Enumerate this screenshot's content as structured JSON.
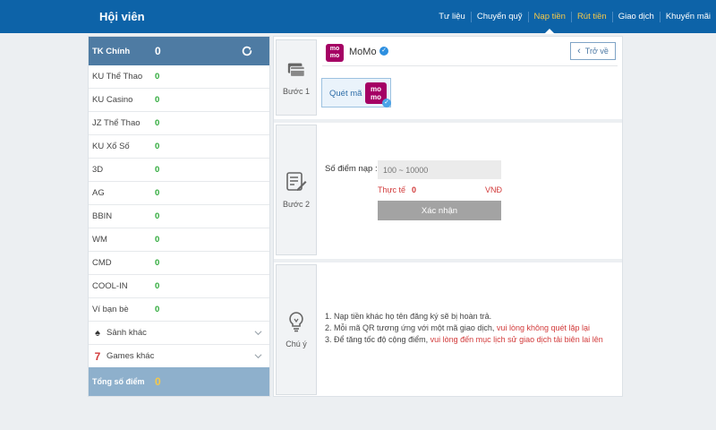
{
  "header": {
    "brand": "Hội viên",
    "nav": [
      "Tư liệu",
      "Chuyển quỹ",
      "Nạp tiền",
      "Rút tiền",
      "Giao dịch",
      "Khuyến mãi"
    ]
  },
  "sidebar": {
    "main_label": "TK Chính",
    "main_value": "0",
    "accounts": [
      {
        "label": "KU Thể Thao",
        "value": "0"
      },
      {
        "label": "KU Casino",
        "value": "0"
      },
      {
        "label": "JZ Thể Thao",
        "value": "0"
      },
      {
        "label": "KU Xổ Số",
        "value": "0"
      },
      {
        "label": "3D",
        "value": "0"
      },
      {
        "label": "AG",
        "value": "0"
      },
      {
        "label": "BBIN",
        "value": "0"
      },
      {
        "label": "WM",
        "value": "0"
      },
      {
        "label": "CMD",
        "value": "0"
      },
      {
        "label": "COOL-IN",
        "value": "0"
      },
      {
        "label": "Ví bạn bè",
        "value": "0"
      }
    ],
    "other_halls": "Sảnh khác",
    "other_games": "Games khác",
    "total_label": "Tổng số điểm",
    "total_value": "0"
  },
  "step1": {
    "label": "Bước 1",
    "provider_title": "MoMo",
    "provider_logo": "mo mo",
    "back_label": "Trở về",
    "qr_label": "Quét mã",
    "qr_logo": "mo mo"
  },
  "step2": {
    "label": "Bước 2",
    "amount_label": "Số điểm nạp :",
    "amount_placeholder": "100 ~ 10000",
    "actual_label": "Thực tế",
    "actual_value": "0",
    "currency": "VNĐ",
    "confirm_label": "Xác nhận"
  },
  "notes": {
    "label": "Chú ý",
    "n1": "1.   Nạp tiền khác họ tên đăng ký sẽ bị hoàn trả.",
    "n2_a": "2.   Mỗi mã QR tương ứng với một mã giao dịch, ",
    "n2_b": "vui lòng không quét lặp lại",
    "n3_a": "3.   Để tăng tốc độ cộng điểm, ",
    "n3_b": "vui lòng đến mục lịch sử giao dịch tải biên lai lên"
  },
  "colors": {
    "header_bg": "#0d63a8",
    "accent_gold": "#f7c948",
    "sidebar_header": "#4e7ba3",
    "sidebar_footer": "#8eb0cc",
    "momo": "#a50064",
    "value_green": "#2eaa3a",
    "warning_red": "#d23a3a"
  }
}
